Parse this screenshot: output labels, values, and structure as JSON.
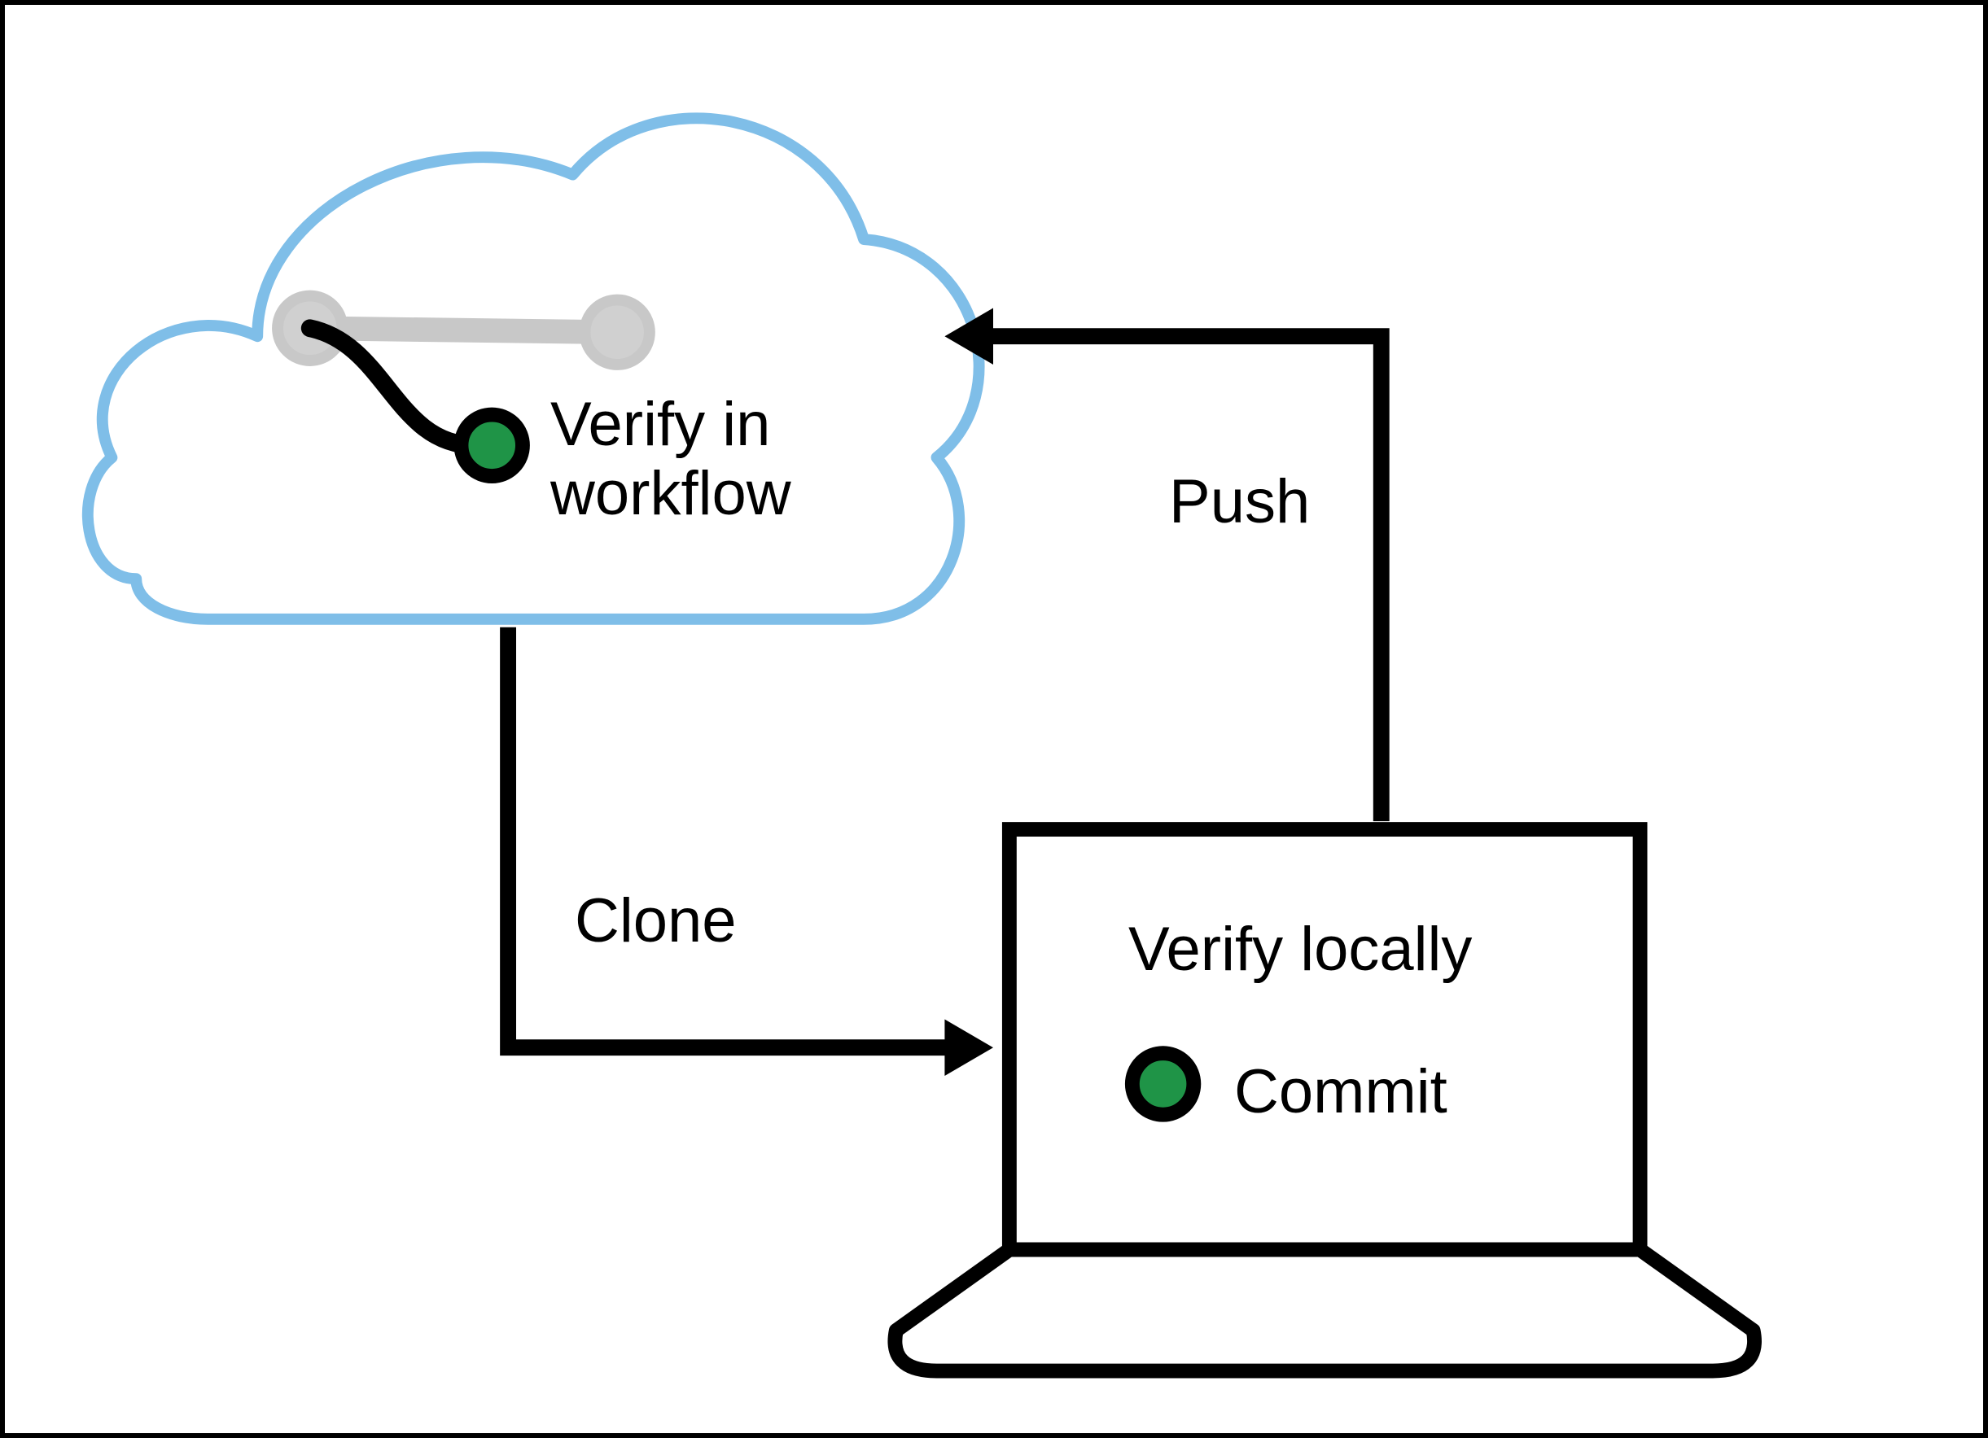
{
  "diagram": {
    "cloud": {
      "label_line1": "Verify in",
      "label_line2": "workflow"
    },
    "laptop": {
      "label1": "Verify locally",
      "label2": "Commit"
    },
    "arrows": {
      "clone": "Clone",
      "push": "Push"
    },
    "colors": {
      "cloud_stroke": "#7fbee8",
      "branch_stroke_inactive": "#c8c8c8",
      "branch_node_fill": "#d0d0d0",
      "commit_fill": "#1f9447",
      "black": "#000"
    }
  }
}
